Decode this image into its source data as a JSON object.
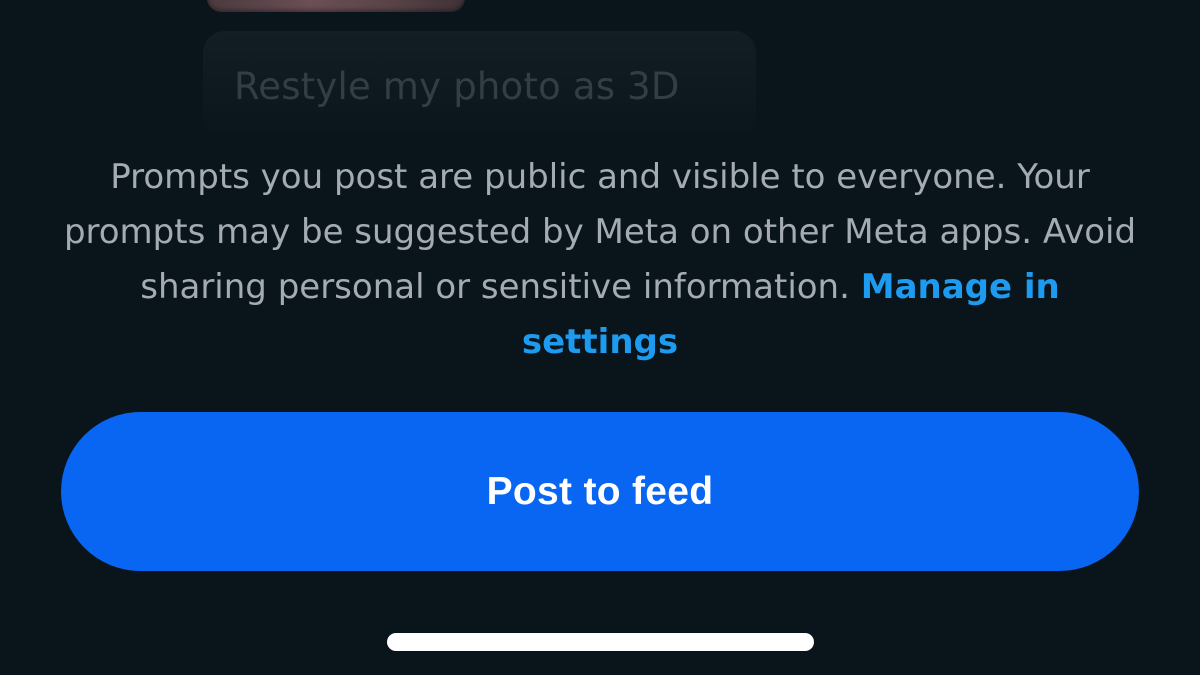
{
  "prompt_chip": {
    "text": "Restyle my photo as 3D"
  },
  "disclaimer": {
    "text": "Prompts you post are public and visible to everyone. Your prompts may be suggested by Meta on other Meta apps. Avoid sharing personal or sensitive information.",
    "link_label": "Manage in settings"
  },
  "actions": {
    "post_label": "Post to feed"
  },
  "colors": {
    "background": "#0a141b",
    "primary_button": "#0866f2",
    "link": "#1d9bf0",
    "body_text": "#a4abb1"
  }
}
